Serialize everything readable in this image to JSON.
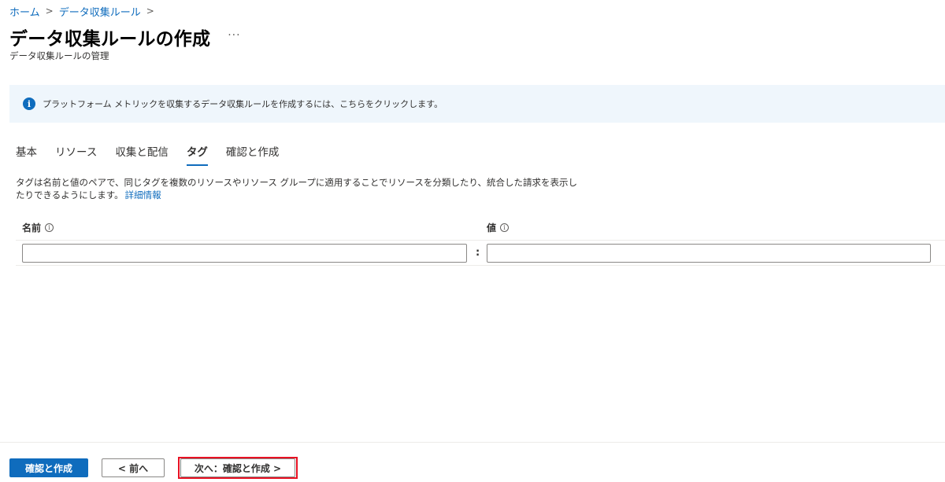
{
  "breadcrumb": {
    "items": [
      "ホーム",
      "データ収集ルール"
    ],
    "separator": ">"
  },
  "header": {
    "title": "データ収集ルールの作成",
    "more": "···",
    "subtitle": "データ収集ルールの管理"
  },
  "banner": {
    "icon": "info-icon",
    "icon_glyph": "i",
    "text": "プラットフォーム メトリックを収集するデータ収集ルールを作成するには、こちらをクリックします。"
  },
  "tabs": [
    {
      "label": "基本",
      "active": false
    },
    {
      "label": "リソース",
      "active": false
    },
    {
      "label": "収集と配信",
      "active": false
    },
    {
      "label": "タグ",
      "active": true
    },
    {
      "label": "確認と作成",
      "active": false
    }
  ],
  "description": {
    "text": "タグは名前と値のペアで、同じタグを複数のリソースやリソース グループに適用することでリソースを分類したり、統合した請求を表示したりできるようにします。",
    "link": "詳細情報"
  },
  "tag_table": {
    "name_header": "名前",
    "value_header": "値",
    "hint_glyph": "i",
    "colon": ":",
    "row": {
      "name_value": "",
      "value_value": ""
    }
  },
  "footer": {
    "review_create": "確認と作成",
    "previous": "< 前へ",
    "next": "次へ：確認と作成 >"
  },
  "colors": {
    "accent": "#0f6cbd",
    "banner_bg": "#eff6fc",
    "highlight": "#e81123"
  }
}
